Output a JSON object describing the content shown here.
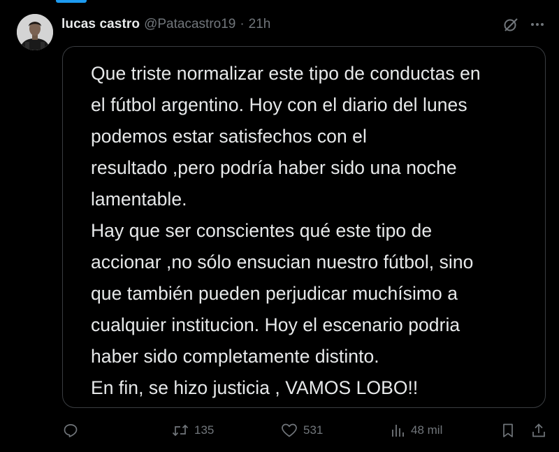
{
  "author": {
    "display_name": "lucas castro",
    "handle": "@Patacastro19",
    "separator": "·",
    "time": "21h"
  },
  "tweet": {
    "text": "Que triste normalizar este tipo de conductas en\nel fútbol argentino. Hoy con el diario del lunes\npodemos estar satisfechos con el\nresultado ,pero podría haber sido una noche\nlamentable.\nHay que ser conscientes qué este tipo de\naccionar ,no sólo ensucian nuestro fútbol, sino\nque también  pueden perjudicar muchísimo a\ncualquier institucion. Hoy el escenario podria\nhaber sido completamente distinto.\nEn fin, se hizo justicia , VAMOS LOBO!!"
  },
  "actions": {
    "reply_count": "",
    "retweet_count": "135",
    "like_count": "531",
    "views_count": "48 mil"
  },
  "icons": {
    "grok": "grok-icon",
    "more": "more-icon",
    "reply": "reply-icon",
    "retweet": "retweet-icon",
    "like": "heart-icon",
    "views": "views-icon",
    "bookmark": "bookmark-icon",
    "share": "share-icon"
  },
  "colors": {
    "background": "#000000",
    "text": "#e7e9ea",
    "muted": "#71767b",
    "border": "#3a3d41",
    "accent": "#1d9bf0"
  }
}
